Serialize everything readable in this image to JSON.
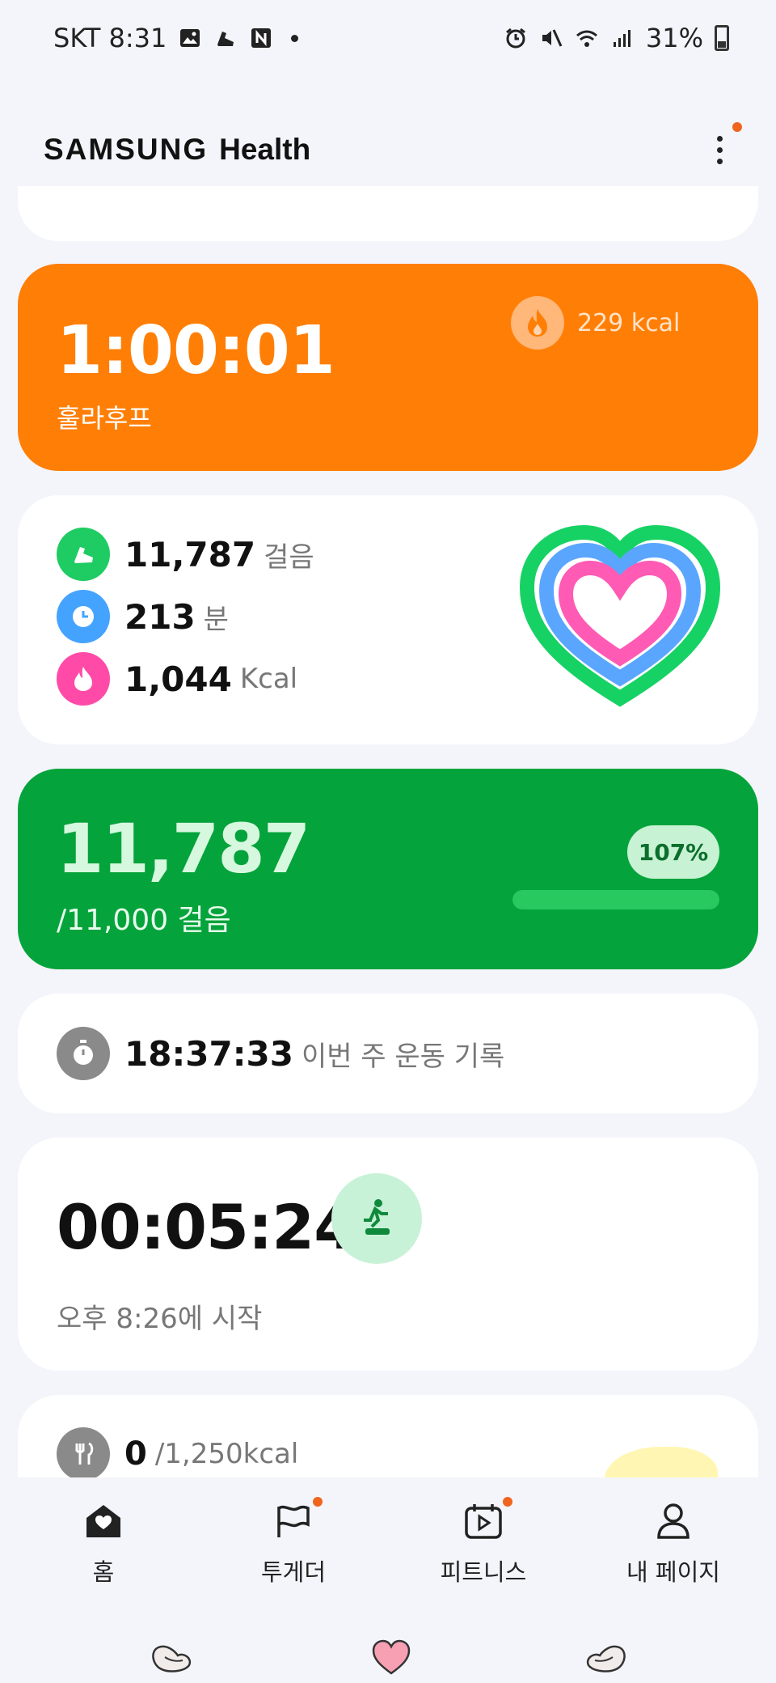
{
  "status_bar": {
    "carrier_time": "SKT 8:31",
    "battery": "31%",
    "icons": [
      "gallery-icon",
      "shoe-icon",
      "n-icon",
      "alarm-icon",
      "mute-icon",
      "wifi-icon",
      "signal-icon",
      "battery-icon"
    ]
  },
  "header": {
    "brand": "SAMSUNG",
    "brand_suffix": "Health"
  },
  "workout": {
    "duration": "1:00:01",
    "name": "훌라후프",
    "calories": "229 kcal",
    "color": "#ff7f06"
  },
  "activity": {
    "steps_value": "11,787",
    "steps_unit": "걸음",
    "minutes_value": "213",
    "minutes_unit": "분",
    "kcal_value": "1,044",
    "kcal_unit": "Kcal",
    "colors": {
      "steps": "#1fcc63",
      "minutes": "#44a3ff",
      "kcal": "#ff4aa8"
    }
  },
  "steps": {
    "value": "11,787",
    "goal": "/11,000 걸음",
    "percent_label": "107%",
    "progress": 1.0,
    "color": "#05a33b"
  },
  "weekly": {
    "value": "18:37:33",
    "label": "이번 주 운동 기록"
  },
  "timer": {
    "value": "00:05:24",
    "start_label": "오후 8:26에 시작"
  },
  "food": {
    "value": "0",
    "goal": "/1,250kcal"
  },
  "nav": {
    "items": [
      {
        "label": "홈",
        "icon": "home-icon",
        "badge": false
      },
      {
        "label": "투게더",
        "icon": "flag-icon",
        "badge": true
      },
      {
        "label": "피트니스",
        "icon": "fitness-icon",
        "badge": true
      },
      {
        "label": "내 페이지",
        "icon": "person-icon",
        "badge": false
      }
    ]
  }
}
